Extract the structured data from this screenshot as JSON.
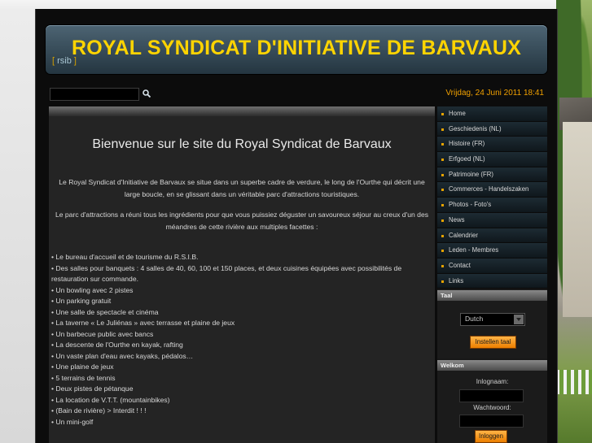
{
  "header": {
    "title": "ROYAL SYNDICAT D'INITIATIVE DE BARVAUX",
    "abbr_left": "[",
    "abbr": "rsib",
    "abbr_right": "]"
  },
  "topbar": {
    "search_placeholder": "",
    "date": "Vrijdag, 24 Juni 2011 18:41"
  },
  "content": {
    "welcome": "Bienvenue sur le site du Royal Syndicat de Barvaux",
    "paragraph1": "Le Royal Syndicat d'Initiative de Barvaux se situe dans un superbe cadre de verdure, le long de l'Ourthe qui décrit une large boucle, en se glissant dans un véritable parc d'attractions touristiques.",
    "paragraph2": "Le parc d'attractions a réuni tous les ingrédients pour que vous puissiez déguster un savoureux séjour au creux d'un des méandres de cette rivière aux multiples facettes :",
    "items": [
      "Le bureau d'accueil et de tourisme du R.S.I.B.",
      "Des salles pour banquets : 4 salles de 40, 60, 100 et 150 places, et deux cuisines équipées avec possibilités de restauration sur commande.",
      "Un bowling avec 2 pistes",
      "Un parking gratuit",
      "Une salle de spectacle et cinéma",
      "La taverne « Le Juliénas » avec terrasse et plaine de jeux",
      "Un barbecue public avec bancs",
      "La descente de l'Ourthe en kayak, rafting",
      "Un vaste plan d'eau avec kayaks, pédalos…",
      "Une plaine de jeux",
      "5 terrains de tennis",
      "Deux pistes de pétanque",
      "La location de V.T.T. (mountainbikes)",
      "(Bain de rivière) > Interdit ! ! !",
      "Un mini-golf"
    ]
  },
  "sidebar": {
    "menu": [
      "Home",
      "Geschiedenis (NL)",
      "Histoire (FR)",
      "Erfgoed (NL)",
      "Patrimoine (FR)",
      "Commerces - Handelszaken",
      "Photos - Foto's",
      "News",
      "Calendrier",
      "Leden - Membres",
      "Contact",
      "Links"
    ],
    "taal": {
      "title": "Taal",
      "selected": "Dutch",
      "button": "Instellen taal"
    },
    "login": {
      "title": "Welkom",
      "user_label": "Inlognaam:",
      "pass_label": "Wachtwoord:",
      "button": "Inloggen"
    }
  },
  "colors": {
    "title": "#ffd400",
    "accent": "#f0a000",
    "button": "#ec7f00"
  }
}
